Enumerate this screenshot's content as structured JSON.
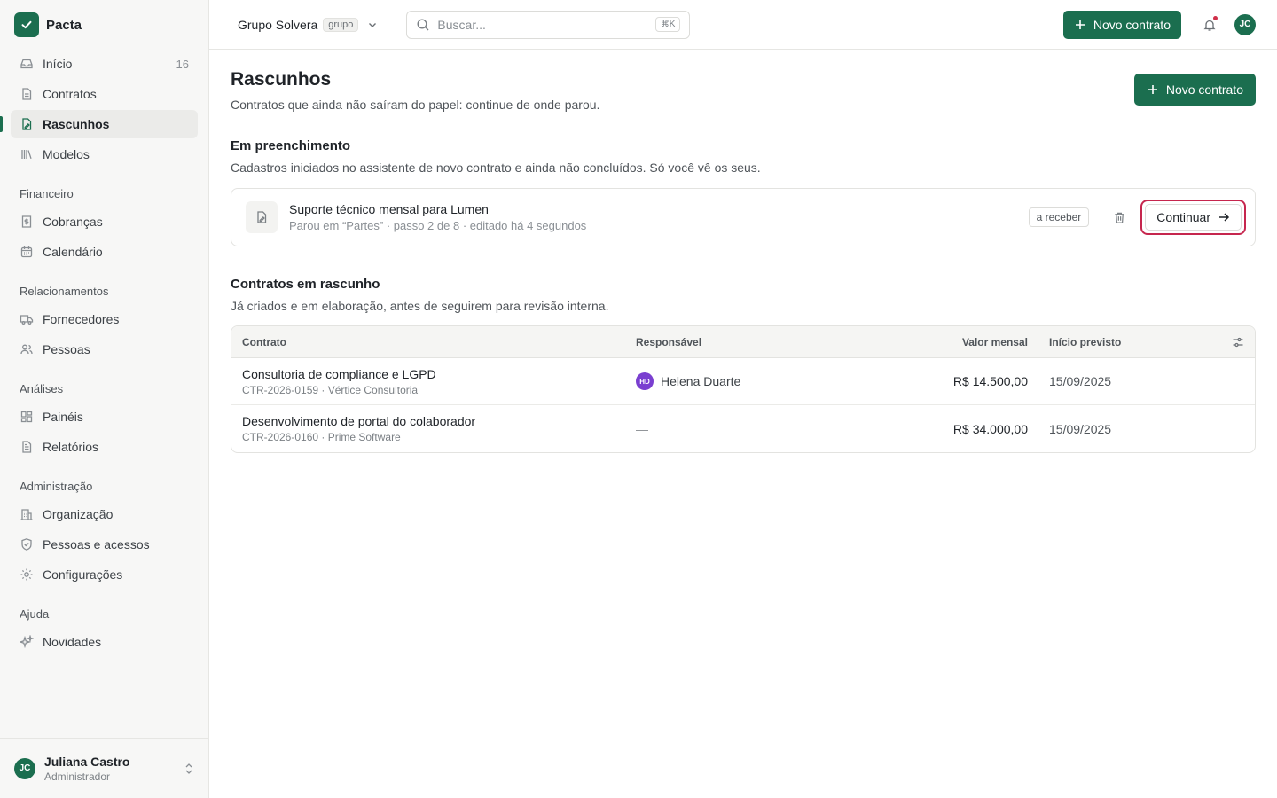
{
  "brand": {
    "name": "Pacta",
    "accent": "#1b6e4f"
  },
  "sidebar": {
    "items": [
      {
        "label": "Início",
        "count": "16",
        "icon": "inbox-icon"
      },
      {
        "label": "Contratos",
        "icon": "file-icon"
      },
      {
        "label": "Rascunhos",
        "icon": "draft-icon",
        "active": true
      },
      {
        "label": "Modelos",
        "icon": "library-icon"
      }
    ],
    "sections": [
      {
        "title": "Financeiro",
        "items": [
          {
            "label": "Cobranças",
            "icon": "receipt-icon"
          },
          {
            "label": "Calendário",
            "icon": "calendar-icon"
          }
        ]
      },
      {
        "title": "Relacionamentos",
        "items": [
          {
            "label": "Fornecedores",
            "icon": "truck-icon"
          },
          {
            "label": "Pessoas",
            "icon": "people-icon"
          }
        ]
      },
      {
        "title": "Análises",
        "items": [
          {
            "label": "Painéis",
            "icon": "dashboard-icon"
          },
          {
            "label": "Relatórios",
            "icon": "report-icon"
          }
        ]
      },
      {
        "title": "Administração",
        "items": [
          {
            "label": "Organização",
            "icon": "building-icon"
          },
          {
            "label": "Pessoas e acessos",
            "icon": "shield-icon"
          },
          {
            "label": "Configurações",
            "icon": "gear-icon"
          }
        ]
      },
      {
        "title": "Ajuda",
        "items": [
          {
            "label": "Novidades",
            "icon": "sparkles-icon"
          }
        ]
      }
    ],
    "user": {
      "initials": "JC",
      "name": "Juliana Castro",
      "role": "Administrador"
    }
  },
  "topbar": {
    "org_name": "Grupo Solvera",
    "org_badge": "grupo",
    "search_placeholder": "Buscar...",
    "search_shortcut": "⌘K",
    "new_contract_label": "Novo contrato",
    "avatar_initials": "JC",
    "notification_dot_color": "#d0304a"
  },
  "page": {
    "title": "Rascunhos",
    "subtitle": "Contratos que ainda não saíram do papel: continue de onde parou.",
    "new_contract_label": "Novo contrato"
  },
  "in_progress": {
    "title": "Em preenchimento",
    "description": "Cadastros iniciados no assistente de novo contrato e ainda não concluídos. Só você vê os seus.",
    "card": {
      "title": "Suporte técnico mensal para Lumen",
      "meta": "Parou em “Partes” · passo 2 de 8 · editado há 4 segundos",
      "tag": "a receber",
      "continue_label": "Continuar"
    }
  },
  "drafts": {
    "title": "Contratos em rascunho",
    "description": "Já criados e em elaboração, antes de seguirem para revisão interna.",
    "columns": {
      "contract": "Contrato",
      "owner": "Responsável",
      "monthly_value": "Valor mensal",
      "start": "Início previsto"
    },
    "rows": [
      {
        "title": "Consultoria de compliance e LGPD",
        "sub": "CTR-2026-0159 · Vértice Consultoria",
        "owner_initials": "HD",
        "owner_name": "Helena Duarte",
        "value": "R$ 14.500,00",
        "start": "15/09/2025"
      },
      {
        "title": "Desenvolvimento de portal do colaborador",
        "sub": "CTR-2026-0160 · Prime Software",
        "owner_empty": "—",
        "value": "R$ 34.000,00",
        "start": "15/09/2025"
      }
    ]
  }
}
